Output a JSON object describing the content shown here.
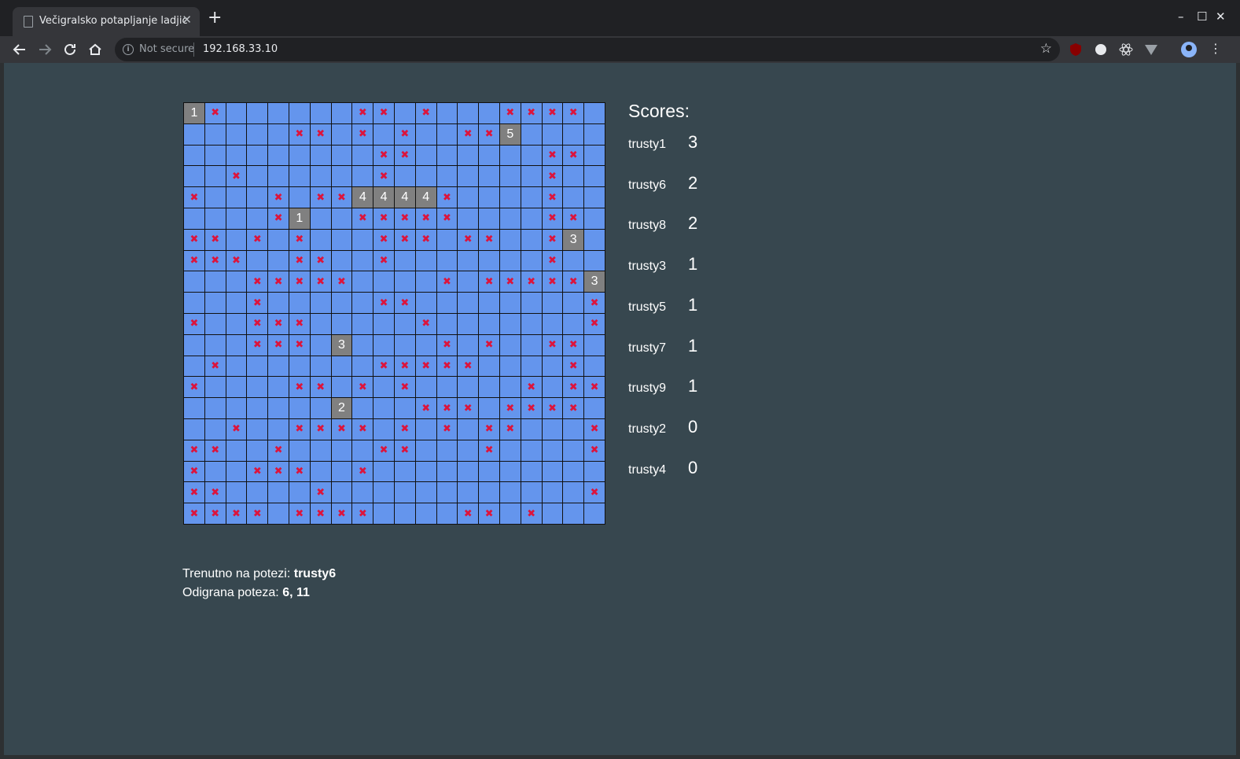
{
  "browser": {
    "tab_title": "Večigralsko potapljanje ladjic",
    "security_label": "Not secure",
    "url": "192.168.33.10"
  },
  "scores": {
    "title": "Scores:",
    "rows": [
      {
        "name": "trusty1",
        "score": "3"
      },
      {
        "name": "trusty6",
        "score": "2"
      },
      {
        "name": "trusty8",
        "score": "2"
      },
      {
        "name": "trusty3",
        "score": "1"
      },
      {
        "name": "trusty5",
        "score": "1"
      },
      {
        "name": "trusty7",
        "score": "1"
      },
      {
        "name": "trusty9",
        "score": "1"
      },
      {
        "name": "trusty2",
        "score": "0"
      },
      {
        "name": "trusty4",
        "score": "0"
      }
    ]
  },
  "status": {
    "turn_label": "Trenutno na potezi:",
    "turn_player": "trusty6",
    "move_label": "Odigrana poteza:",
    "move_value": "6, 11"
  },
  "board": {
    "size": 20,
    "miss_symbol": "✖",
    "legend": ". = empty, x = miss, digit = hit ship of player number",
    "rows": [
      "1x......xx.x...xxxx.",
      ".....xx.x.x..xx5....",
      ".........xx......xx.",
      "..x......x.......x..",
      "x...x.xx4444x....x..",
      "....x1..xxxxx....xx.",
      "xx.x.x...xxx.xx..x3.",
      "xxx..xx..x.......x..",
      "...xxxxx....x.xxxxx3",
      "...x.....xx........x",
      "x..xxx.....x.......x",
      "...xxx.3....x.x..xx.",
      ".x.......xxxxx....x.",
      "x....xx.x.x.....x.xx",
      ".......2...xxx.xxxx.",
      "..x..xxxx.x.x.xx...x",
      "xx..x....xx...x....x",
      "x..xxx..x...........",
      "xx....x............x",
      "xxxx.xxxx....xx.x..."
    ]
  },
  "colors": {
    "page_bg": "#37474f",
    "water": "#6495ed",
    "hit": "#808080",
    "miss": "#dc143c"
  }
}
